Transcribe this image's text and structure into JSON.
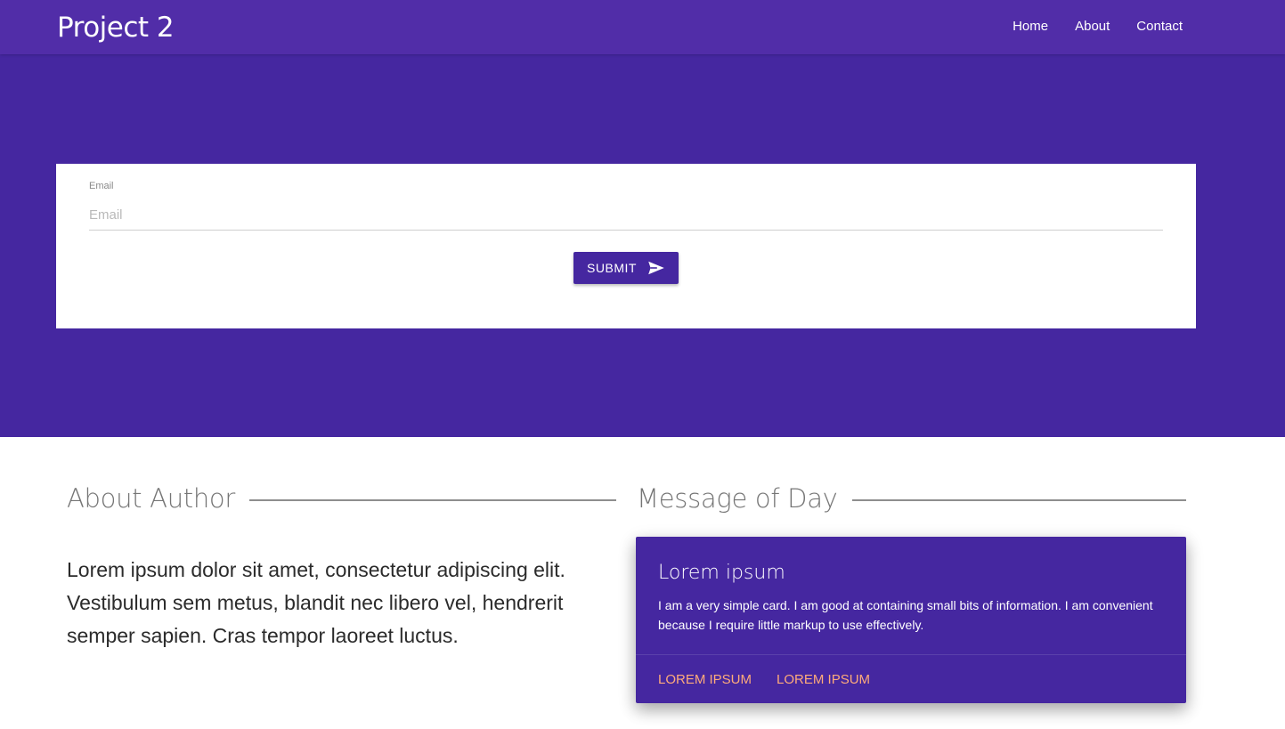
{
  "navbar": {
    "brand": "Project 2",
    "links": [
      {
        "label": "Home"
      },
      {
        "label": "About"
      },
      {
        "label": "Contact"
      }
    ]
  },
  "form": {
    "email_label": "Email",
    "email_placeholder": "Email",
    "email_value": "",
    "submit_label": "SUBMIT",
    "submit_icon": "send-icon"
  },
  "about": {
    "heading": "About Author",
    "text": "Lorem ipsum dolor sit amet, consectetur adipiscing elit. Vestibulum sem metus, blandit nec libero vel, hendrerit semper sapien. Cras tempor laoreet luctus."
  },
  "message": {
    "heading": "Message of Day",
    "card": {
      "title": "Lorem ipsum",
      "body": "I am a very simple card. I am good at containing small bits of information. I am convenient because I require little markup to use effectively.",
      "actions": [
        {
          "label": "LOREM IPSUM"
        },
        {
          "label": "LOREM IPSUM"
        }
      ]
    }
  },
  "colors": {
    "navbar": "#512da8",
    "hero": "#4527a0",
    "card": "#4527a0",
    "action_link": "#ffab7a"
  }
}
